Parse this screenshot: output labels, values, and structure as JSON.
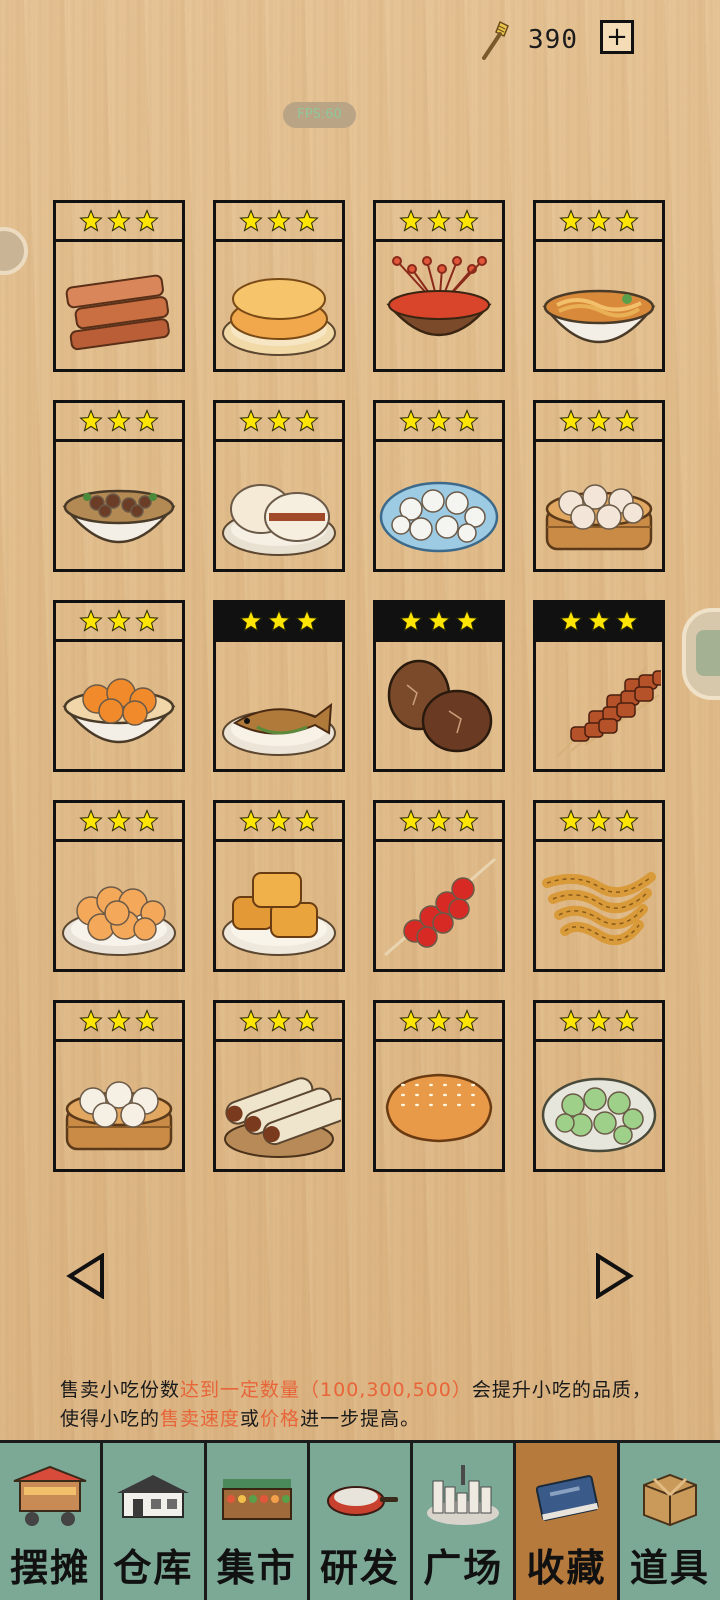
{
  "header": {
    "coin_icon": "spatula-icon",
    "coins": "390",
    "add_label": "+",
    "fps": "FPS:60"
  },
  "collection": {
    "items": [
      {
        "name": "fried-dough-strips",
        "stars": 3,
        "dark": false
      },
      {
        "name": "pancakes",
        "stars": 3,
        "dark": false
      },
      {
        "name": "skewer-hotpot",
        "stars": 3,
        "dark": false
      },
      {
        "name": "noodle-bowl",
        "stars": 3,
        "dark": false
      },
      {
        "name": "beef-soup",
        "stars": 3,
        "dark": false
      },
      {
        "name": "gua-bao",
        "stars": 3,
        "dark": false
      },
      {
        "name": "fish-balls",
        "stars": 3,
        "dark": false
      },
      {
        "name": "soup-dumplings",
        "stars": 3,
        "dark": false
      },
      {
        "name": "fried-chicken",
        "stars": 3,
        "dark": false
      },
      {
        "name": "braised-fish",
        "stars": 3,
        "dark": true
      },
      {
        "name": "tea-eggs",
        "stars": 3,
        "dark": true
      },
      {
        "name": "meat-skewers",
        "stars": 3,
        "dark": true
      },
      {
        "name": "potato-chips",
        "stars": 3,
        "dark": false
      },
      {
        "name": "fried-tofu",
        "stars": 3,
        "dark": false
      },
      {
        "name": "tanghulu",
        "stars": 3,
        "dark": false
      },
      {
        "name": "fried-twists",
        "stars": 3,
        "dark": false
      },
      {
        "name": "steamed-buns",
        "stars": 3,
        "dark": false
      },
      {
        "name": "rolls",
        "stars": 3,
        "dark": false
      },
      {
        "name": "sesame-bread",
        "stars": 3,
        "dark": false
      },
      {
        "name": "green-rice-balls",
        "stars": 3,
        "dark": false
      }
    ]
  },
  "pager": {
    "prev_icon": "triangle-left-icon",
    "next_icon": "triangle-right-icon"
  },
  "description": {
    "part1": "售卖小吃份数",
    "hl1": "达到一定数量（100,300,500）",
    "part2": "会提升小吃的品质，使得小吃的",
    "hl2": "售卖速度",
    "part3": "或",
    "hl3": "价格",
    "part4": "进一步提高。",
    "highlight_color": "#e8653a"
  },
  "tabs": [
    {
      "label": "摆摊",
      "icon": "food-cart-icon",
      "active": false
    },
    {
      "label": "仓库",
      "icon": "warehouse-icon",
      "active": false
    },
    {
      "label": "集市",
      "icon": "market-stall-icon",
      "active": false
    },
    {
      "label": "研发",
      "icon": "frying-pan-icon",
      "active": false
    },
    {
      "label": "广场",
      "icon": "city-plaza-icon",
      "active": false
    },
    {
      "label": "收藏",
      "icon": "book-icon",
      "active": true
    },
    {
      "label": "道具",
      "icon": "box-icon",
      "active": false
    }
  ],
  "colors": {
    "tab_bg": "#7ca896",
    "tab_active": "#b67a3d",
    "star": "#ffe500"
  }
}
